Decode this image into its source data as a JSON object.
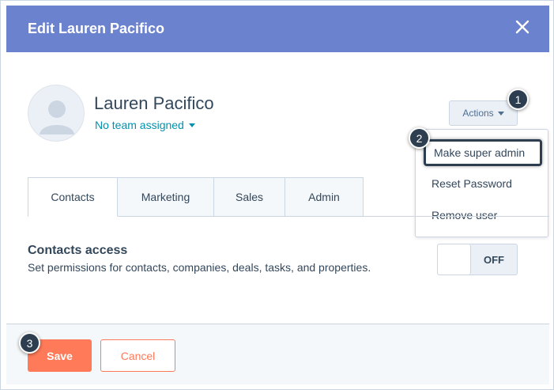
{
  "header": {
    "title": "Edit Lauren Pacifico",
    "close_icon": "close-icon",
    "color": "#6b82cf"
  },
  "user": {
    "name": "Lauren Pacifico",
    "team_label": "No team assigned",
    "avatar_icon": "user-avatar-icon"
  },
  "actions": {
    "label": "Actions",
    "menu": [
      {
        "label": "Make super admin",
        "highlighted": true
      },
      {
        "label": "Reset Password"
      },
      {
        "label": "Remove user"
      }
    ]
  },
  "tabs": [
    {
      "label": "Contacts",
      "active": true
    },
    {
      "label": "Marketing"
    },
    {
      "label": "Sales"
    },
    {
      "label": "Admin"
    }
  ],
  "contacts_access": {
    "title": "Contacts access",
    "description": "Set permissions for contacts, companies, deals, tasks, and properties.",
    "toggle_state": "OFF"
  },
  "footer": {
    "save_label": "Save",
    "cancel_label": "Cancel",
    "accent": "#ff7a59"
  },
  "step_badges": [
    "1",
    "2",
    "3"
  ]
}
